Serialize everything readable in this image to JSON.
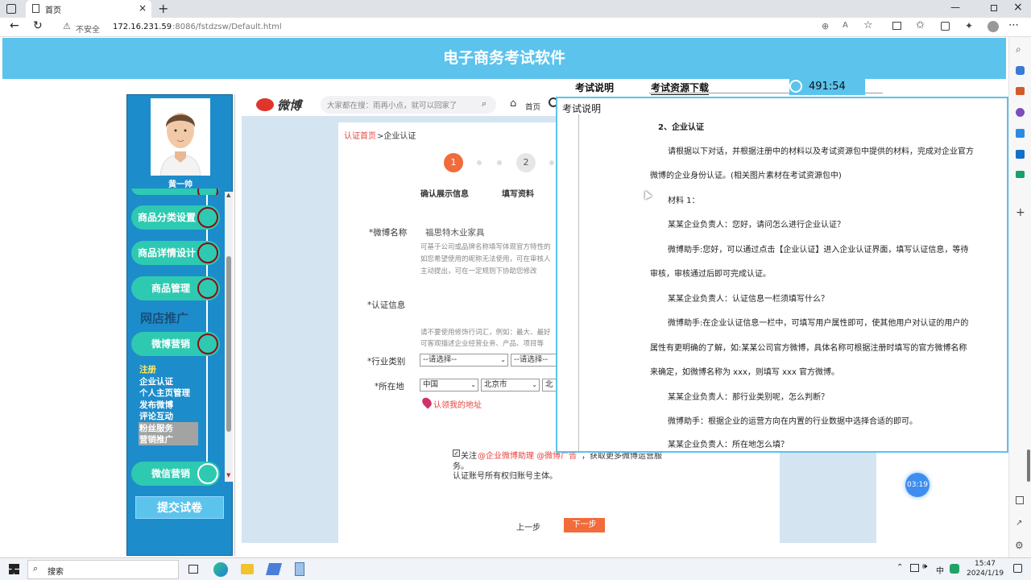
{
  "browser": {
    "tab_title": "首页",
    "security_label": "不安全",
    "url_host": "172.16.231.59",
    "url_rest": ":8086/fstdzsw/Default.html"
  },
  "app": {
    "title": "电子商务考试软件",
    "menu_exam_desc": "考试说明",
    "menu_resource_download": "考试资源下载",
    "timer": "491:54",
    "user_name": "黄一帅",
    "submit_label": "提交试卷",
    "floating_timer": "03:19"
  },
  "nav": {
    "pills": {
      "category": "商品分类设置",
      "detail": "商品详情设计",
      "manage": "商品管理",
      "weibo": "微博营销",
      "wechat": "微信营销"
    },
    "section_heading": "网店推广",
    "sub_items": [
      "注册",
      "企业认证",
      "个人主页管理",
      "发布微博",
      "评论互动",
      "粉丝服务",
      "营销推广"
    ]
  },
  "weibo": {
    "logo_text": "微博",
    "search_placeholder": "大家都在搜：雨再小点，就可以回家了",
    "home_label": "首页",
    "breadcrumb_link": "认证首页",
    "breadcrumb_rest": ">企业认证",
    "step1_num": "1",
    "step2_num": "2",
    "step1_label": "确认展示信息",
    "step2_label": "填写资料",
    "name_label": "*微博名称",
    "name_value": "福思特木业家具",
    "name_hint_1": "可基于公司或品牌名称填写体现官方特性的",
    "name_hint_2": "如您希望使用的昵称无法使用，可在审核人",
    "name_hint_3": "主动提出，可在一定规则下协助您修改",
    "auth_label": "*认证信息",
    "auth_hint_1": "请不要使用修饰行词汇，例如：最大、最好",
    "auth_hint_2": "可客观描述企业经营业务、产品、项目等",
    "industry_label": "*行业类别",
    "select_placeholder": "--请选择--",
    "location_label": "*所在地",
    "country": "中国",
    "city": "北京市",
    "district_partial": "北",
    "locate_label": "认领我的地址",
    "follow_prefix": "关注",
    "follow_links": "@企业微博助理 @微博广告",
    "follow_suffix": "，获取更多微博运营服",
    "follow_line2": "务。",
    "ownership_note": "认证账号所有权归账号主体。",
    "prev_btn": "上一步",
    "next_btn": "下一步"
  },
  "modal": {
    "title": "考试说明",
    "paragraphs": [
      "2、企业认证",
      "请根据以下对话，并根据注册中的材料以及考试资源包中提供的材料，完成对企业官方",
      "微博的企业身份认证。(相关图片素材在考试资源包中)",
      "材料 1：",
      "某某企业负责人：您好，请问怎么进行企业认证？",
      "微博助手:您好，可以通过点击【企业认证】进入企业认证界面，填写认证信息，等待",
      "审核，审核通过后即可完成认证。",
      "某某企业负责人：认证信息一栏须填写什么？",
      "微博助手:在企业认证信息一栏中，可填写用户属性即可，使其他用户对认证的用户的",
      "属性有更明确的了解，如:某某公司官方微博，具体名称可根据注册时填写的官方微博名称",
      "来确定，如微博名称为 xxx，则填写 xxx 官方微博。",
      "某某企业负责人：那行业类别呢，怎么判断？",
      "微博助手：根据企业的运营方向在内置的行业数据中选择合适的即可。",
      "某某企业负责人：所在地怎么填？"
    ]
  },
  "taskbar": {
    "search_label": "搜索",
    "ime": "中",
    "time": "15:47",
    "date": "2024/1/19"
  },
  "colors": {
    "header_blue": "#5bc3ec",
    "nav_blue": "#1d8ccb",
    "pill_teal": "#2ec9b1",
    "ring_red": "#8b0d14",
    "weibo_orange": "#f26b3a",
    "link_red": "#e8433f"
  }
}
